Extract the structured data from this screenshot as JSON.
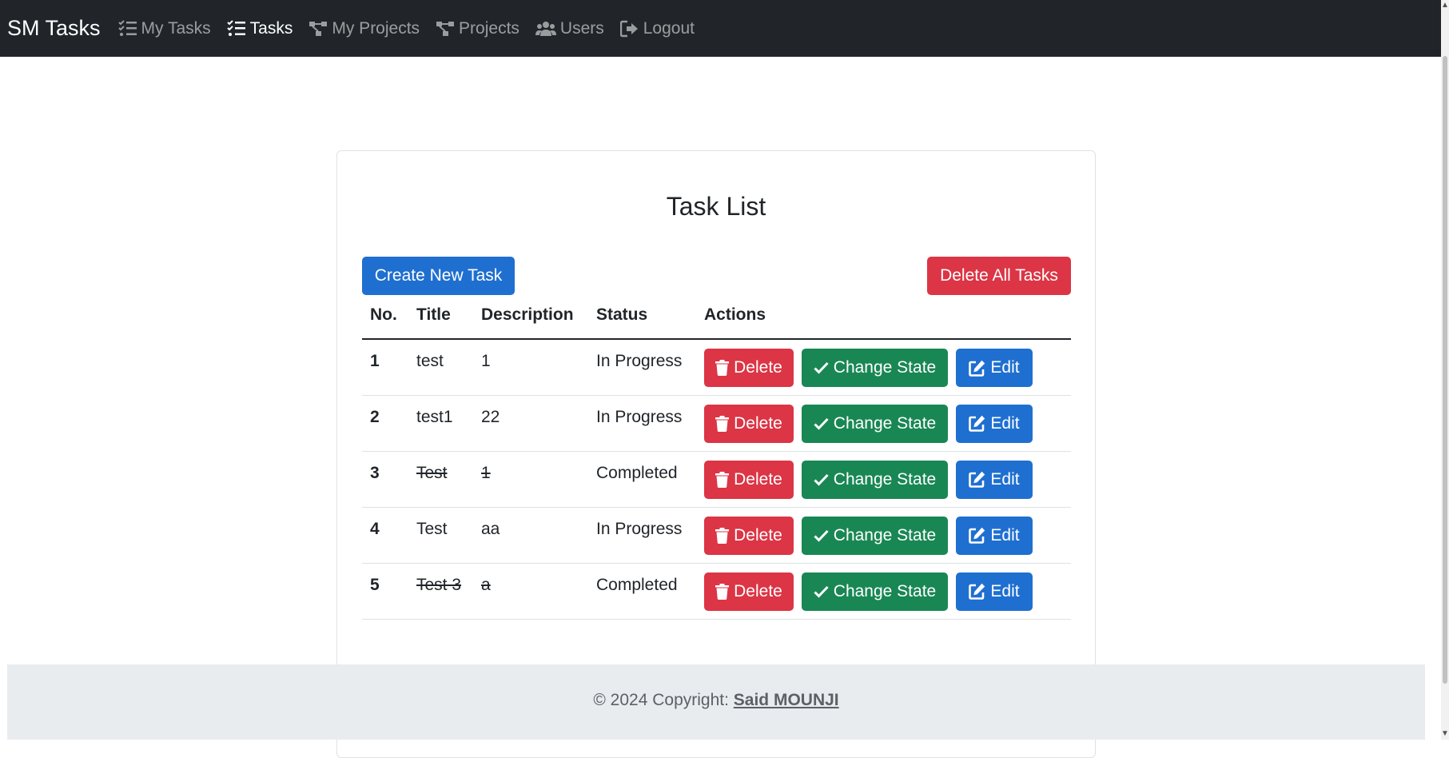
{
  "navbar": {
    "brand": "SM Tasks",
    "items": [
      {
        "label": "My Tasks",
        "icon": "task-list-icon"
      },
      {
        "label": "Tasks",
        "icon": "task-list-icon"
      },
      {
        "label": "My Projects",
        "icon": "project-diagram-icon"
      },
      {
        "label": "Projects",
        "icon": "project-diagram-icon"
      },
      {
        "label": "Users",
        "icon": "users-icon"
      },
      {
        "label": "Logout",
        "icon": "logout-icon"
      }
    ]
  },
  "card": {
    "title": "Task List",
    "create_label": "Create New Task",
    "delete_all_label": "Delete All Tasks"
  },
  "table": {
    "headers": [
      "No.",
      "Title",
      "Description",
      "Status",
      "Actions"
    ],
    "rows": [
      {
        "no": "1",
        "title": "test",
        "description": "1",
        "status": "In Progress",
        "completed": false
      },
      {
        "no": "2",
        "title": "test1",
        "description": "22",
        "status": "In Progress",
        "completed": false
      },
      {
        "no": "3",
        "title": "Test",
        "description": "1",
        "status": "Completed",
        "completed": true
      },
      {
        "no": "4",
        "title": "Test",
        "description": "aa",
        "status": "In Progress",
        "completed": false
      },
      {
        "no": "5",
        "title": "Test 3",
        "description": "a",
        "status": "Completed",
        "completed": true
      }
    ],
    "actions": {
      "delete_label": "Delete",
      "change_state_label": "Change State",
      "edit_label": "Edit"
    }
  },
  "footer": {
    "prefix": "© 2024 Copyright: ",
    "author": "Said MOUNJI"
  },
  "colors": {
    "navbar": "#212529",
    "primary": "#1f6fd1",
    "danger": "#dc3545",
    "success": "#198754",
    "footer": "#e9ecef"
  }
}
